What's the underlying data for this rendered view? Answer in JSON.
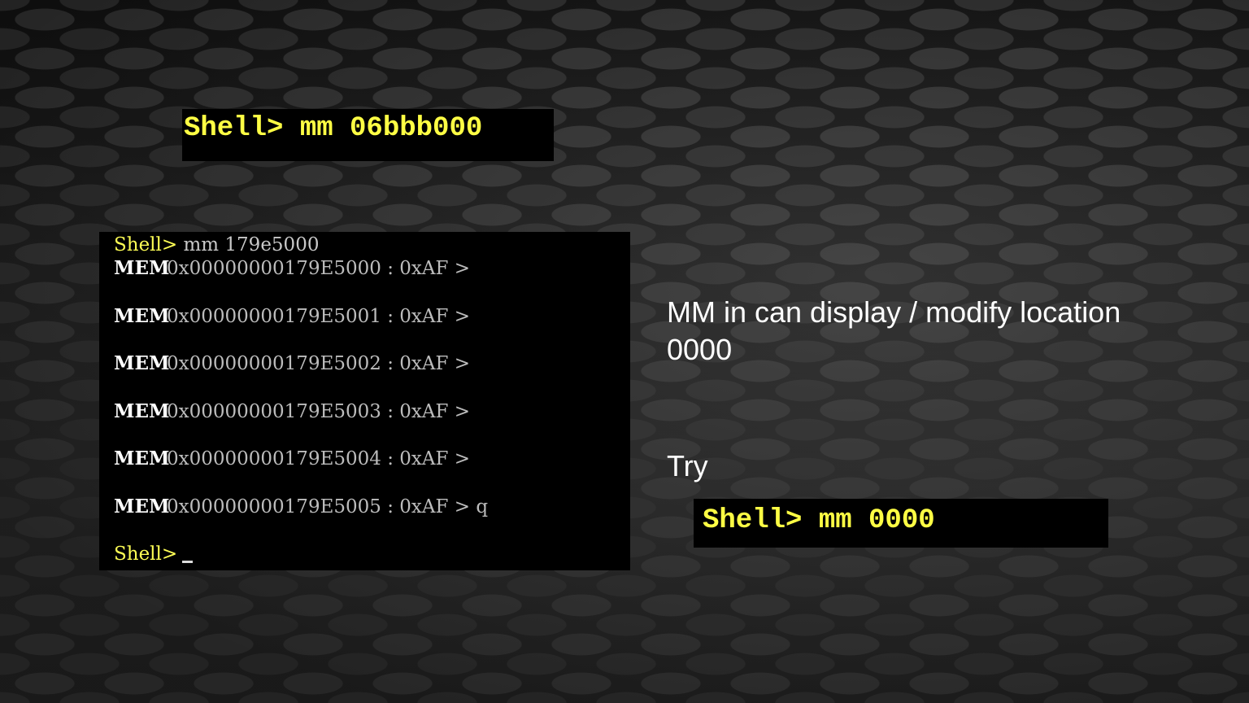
{
  "top_command": "Shell> mm 06bbb000",
  "terminal": {
    "prompt": "Shell>",
    "command": "mm 179e5000",
    "rows": [
      {
        "label": "MEM",
        "text": "0x00000000179E5000 : 0xAF >"
      },
      {
        "label": "MEM",
        "text": "0x00000000179E5001 : 0xAF >"
      },
      {
        "label": "MEM",
        "text": "0x00000000179E5002 : 0xAF >"
      },
      {
        "label": "MEM",
        "text": "0x00000000179E5003 : 0xAF >"
      },
      {
        "label": "MEM",
        "text": "0x00000000179E5004 : 0xAF >"
      },
      {
        "label": "MEM",
        "text": "0x00000000179E5005 : 0xAF > q"
      }
    ],
    "final_prompt": "Shell>"
  },
  "notes": {
    "main": "MM in can display / modify location 0000",
    "try_label": "Try",
    "try_command": "Shell> mm 0000"
  },
  "colors": {
    "prompt_yellow": "#ffff44",
    "terminal_bg": "#000000",
    "text_white": "#ffffff"
  }
}
